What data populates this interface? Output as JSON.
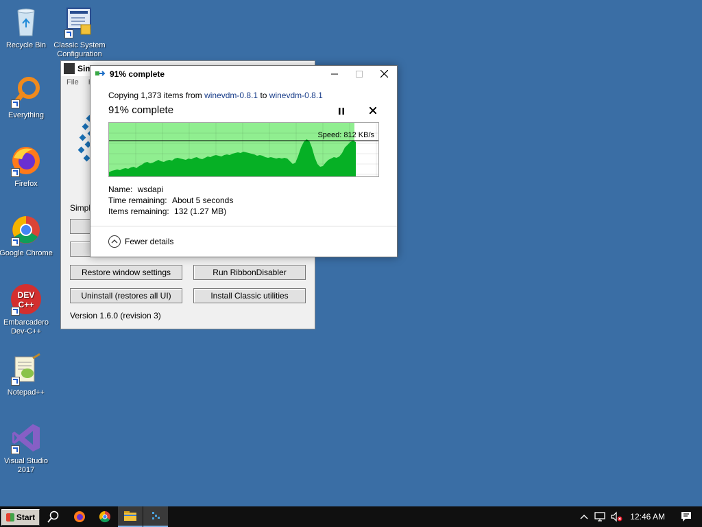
{
  "desktop": {
    "icons": [
      {
        "label": "Recycle Bin",
        "icon": "recycle-bin-icon"
      },
      {
        "label": "Classic System Configuration",
        "icon": "system-config-icon"
      },
      {
        "label": "Everything",
        "icon": "everything-search-icon"
      },
      {
        "label": "Firefox",
        "icon": "firefox-icon"
      },
      {
        "label": "Google Chrome",
        "icon": "chrome-icon"
      },
      {
        "label": "Embarcadero Dev-C++",
        "icon": "devcpp-icon"
      },
      {
        "label": "Notepad++",
        "icon": "notepadpp-icon"
      },
      {
        "label": "Visual Studio 2017",
        "icon": "visual-studio-icon"
      }
    ]
  },
  "background_window": {
    "title": "Sim",
    "menu": [
      "File",
      "H"
    ],
    "simple_label": "Simple",
    "buttons": {
      "restore": "Restore window settings",
      "ribbon": "Run RibbonDisabler",
      "uninstall": "Uninstall (restores all UI)",
      "install": "Install Classic utilities"
    },
    "version": "Version 1.6.0 (revision 3)"
  },
  "copy_dialog": {
    "title": "91% complete",
    "copy_prefix": "Copying 1,373 items from ",
    "source": "winevdm-0.8.1",
    "to_word": " to ",
    "destination": "winevdm-0.8.1",
    "heading": "91% complete",
    "progress": 0.91,
    "speed_label": "Speed: 812 KB/s",
    "name_label": "Name:",
    "name_value": "wsdapi",
    "time_label": "Time remaining:",
    "time_value": "About 5 seconds",
    "items_label": "Items remaining:",
    "items_value": "132 (1.27 MB)",
    "fewer_details": "Fewer details",
    "colors": {
      "graph_fill": "#06b025",
      "graph_bg": "#90ee90"
    }
  },
  "taskbar": {
    "start_label": "Start",
    "pinned": [
      "search-icon",
      "firefox-icon",
      "chrome-icon",
      "file-explorer-icon",
      "simple-classic-icon"
    ],
    "clock": "12:46 AM"
  }
}
